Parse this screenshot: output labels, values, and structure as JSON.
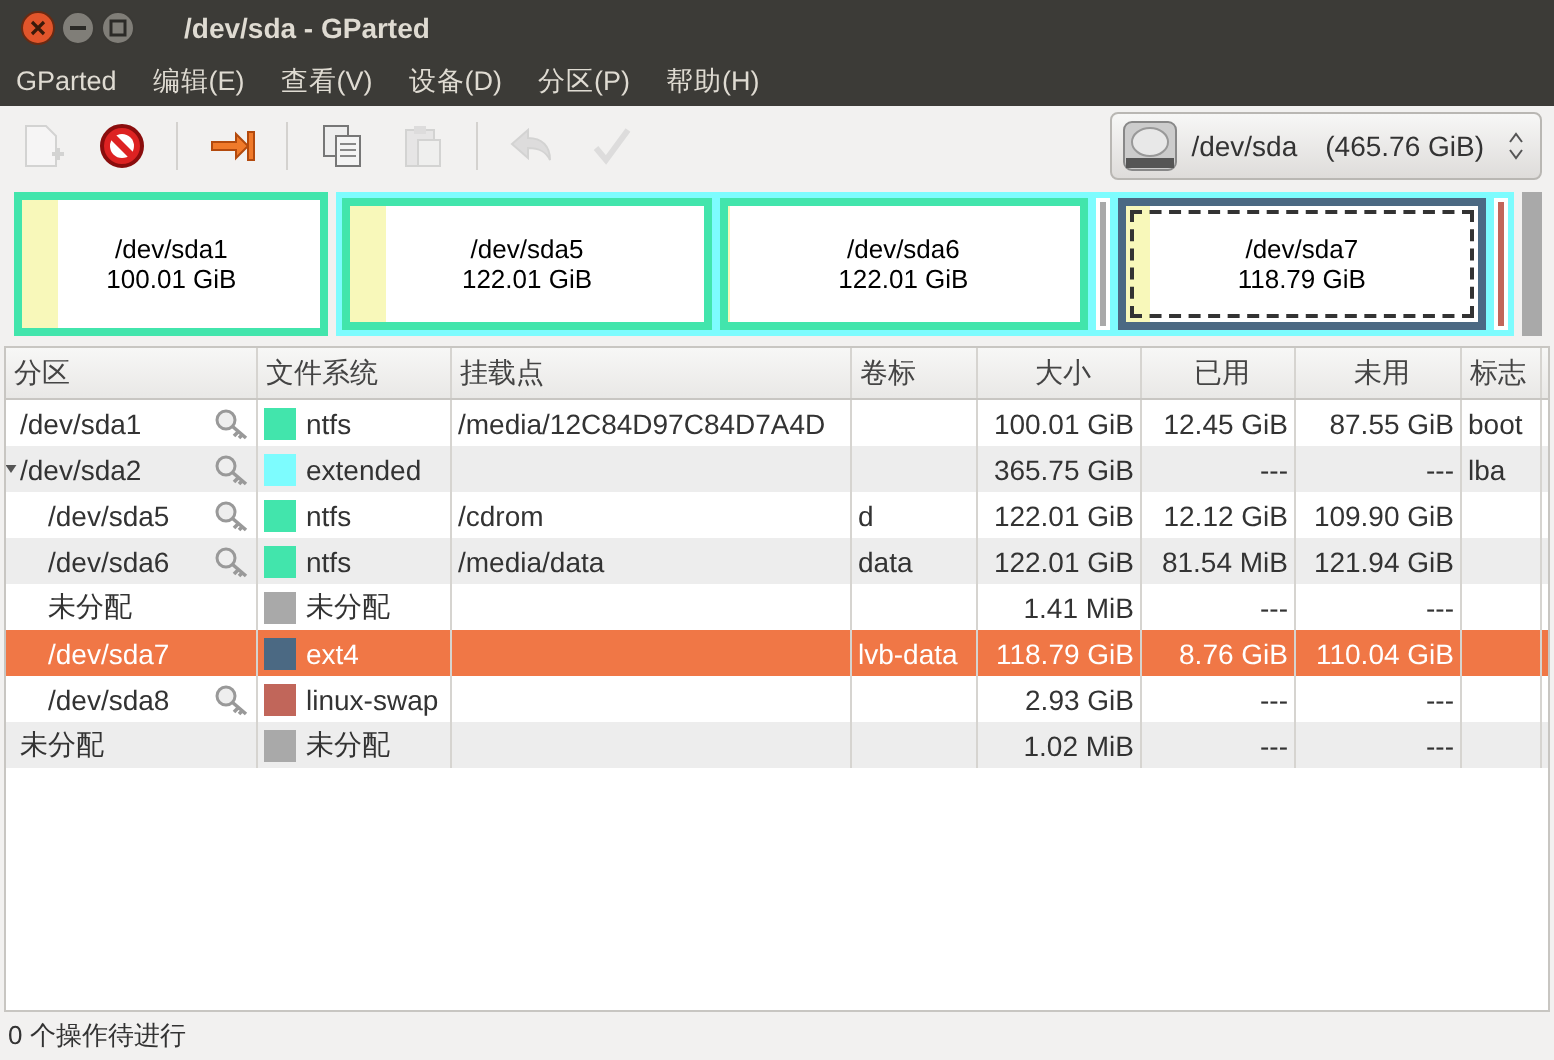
{
  "window": {
    "title": "/dev/sda - GParted"
  },
  "menu": [
    "GParted",
    "编辑(E)",
    "查看(V)",
    "设备(D)",
    "分区(P)",
    "帮助(H)"
  ],
  "toolbar": [
    {
      "kind": "new",
      "disabled": true
    },
    {
      "kind": "delete",
      "disabled": false
    },
    {
      "kind": "separator"
    },
    {
      "kind": "resize",
      "disabled": false
    },
    {
      "kind": "separator"
    },
    {
      "kind": "copy",
      "disabled": false
    },
    {
      "kind": "paste",
      "disabled": true
    },
    {
      "kind": "separator"
    },
    {
      "kind": "undo",
      "disabled": true
    },
    {
      "kind": "apply",
      "disabled": true
    }
  ],
  "device": {
    "name": "/dev/sda",
    "size": "(465.76 GiB)"
  },
  "disk_map": [
    {
      "kind": "partition",
      "name": "/dev/sda1",
      "size": "100.01 GiB",
      "color": "#42e5ac",
      "level": 0.12,
      "selected": false
    },
    {
      "kind": "extended",
      "color": "#7dfcfe",
      "children": [
        {
          "kind": "partition",
          "name": "/dev/sda5",
          "size": "122.01 GiB",
          "color": "#42e5ac",
          "level": 0.1,
          "selected": false
        },
        {
          "kind": "partition",
          "name": "/dev/sda6",
          "size": "122.01 GiB",
          "color": "#42e5ac",
          "level": 0.01,
          "selected": false
        },
        {
          "kind": "sliver",
          "color": "#a9a9a9",
          "selected": false
        },
        {
          "kind": "partition",
          "name": "/dev/sda7",
          "size": "118.79 GiB",
          "color": "#4b6983",
          "level": 0.07,
          "selected": true
        },
        {
          "kind": "sliver",
          "color": "#c1665a",
          "selected": false
        }
      ]
    },
    {
      "kind": "sliver",
      "color": "#a9a9a9",
      "selected": false
    }
  ],
  "table": {
    "columns": [
      "分区",
      "文件系统",
      "挂载点",
      "卷标",
      "大小",
      "已用",
      "未用",
      "标志"
    ],
    "rows": [
      {
        "partition": "/dev/sda1",
        "locked": true,
        "filesystem": "ntfs",
        "color": "#42e5ac",
        "mount": "/media/12C84D97C84D7A4D",
        "size": "100.01 GiB",
        "used": "12.45 GiB",
        "unused": "87.55 GiB",
        "flags": "boot",
        "selected": false
      },
      {
        "partition": "/dev/sda2",
        "locked": true,
        "expanded": true,
        "filesystem": "extended",
        "color": "#7dfcfe",
        "size": "365.75 GiB",
        "used": "---",
        "unused": "---",
        "flags": "lba",
        "selected": false,
        "children": [
          {
            "partition": "/dev/sda5",
            "locked": true,
            "filesystem": "ntfs",
            "color": "#42e5ac",
            "mount": "/cdrom",
            "label": "d",
            "size": "122.01 GiB",
            "used": "12.12 GiB",
            "unused": "109.90 GiB",
            "selected": false
          },
          {
            "partition": "/dev/sda6",
            "locked": true,
            "filesystem": "ntfs",
            "color": "#42e5ac",
            "mount": "/media/data",
            "label": "data",
            "size": "122.01 GiB",
            "used": "81.54 MiB",
            "unused": "121.94 GiB",
            "selected": false
          },
          {
            "partition": "未分配",
            "locked": false,
            "filesystem": "未分配",
            "color": "#a9a9a9",
            "size": "1.41 MiB",
            "used": "---",
            "unused": "---",
            "selected": false
          },
          {
            "partition": "/dev/sda7",
            "locked": false,
            "filesystem": "ext4",
            "color": "#4b6983",
            "label": "lvb-data",
            "size": "118.79 GiB",
            "used": "8.76 GiB",
            "unused": "110.04 GiB",
            "selected": true
          },
          {
            "partition": "/dev/sda8",
            "locked": true,
            "filesystem": "linux-swap",
            "color": "#c1665a",
            "size": "2.93 GiB",
            "used": "---",
            "unused": "---",
            "selected": false
          }
        ]
      },
      {
        "partition": "未分配",
        "locked": false,
        "filesystem": "未分配",
        "color": "#a9a9a9",
        "size": "1.02 MiB",
        "used": "---",
        "unused": "---",
        "selected": false
      }
    ]
  },
  "status_bar": "0 个操作待进行"
}
